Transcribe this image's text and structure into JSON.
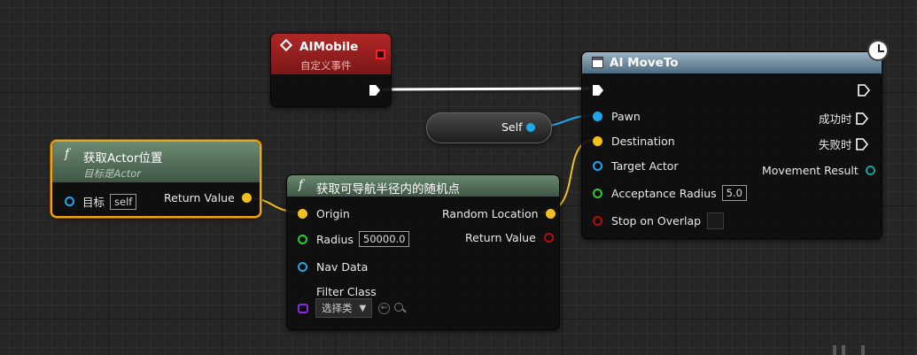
{
  "ai_mobile": {
    "title": "AIMobile",
    "subtitle": "自定义事件"
  },
  "self_node": {
    "label": "Self"
  },
  "get_actor_location": {
    "title": "获取Actor位置",
    "subtitle": "目标是Actor",
    "target_label": "目标",
    "target_value": "self",
    "return_label": "Return Value"
  },
  "random_point": {
    "title": "获取可导航半径内的随机点",
    "origin_label": "Origin",
    "random_location_label": "Random Location",
    "radius_label": "Radius",
    "radius_value": "50000.0",
    "return_label": "Return Value",
    "nav_data_label": "Nav Data",
    "filter_class_label": "Filter Class",
    "filter_class_value": "选择类"
  },
  "ai_move_to": {
    "title": "AI MoveTo",
    "pawn_label": "Pawn",
    "on_success_label": "成功时",
    "destination_label": "Destination",
    "on_fail_label": "失败时",
    "target_actor_label": "Target Actor",
    "movement_result_label": "Movement Result",
    "acceptance_radius_label": "Acceptance Radius",
    "acceptance_radius_value": "5.0",
    "stop_on_overlap_label": "Stop on Overlap"
  },
  "colors": {
    "event_header": "#9a1c1c",
    "function_header": "#52705a",
    "latent_header": "#6c8aa0",
    "selection": "#f2a516",
    "object_pin": "#1fa8ee",
    "vector_pin": "#f0c020",
    "float_pin": "#2ecc2e",
    "bool_pin": "#b01010",
    "class_pin": "#8a2be2",
    "enum_pin": "#1aa0a0"
  }
}
